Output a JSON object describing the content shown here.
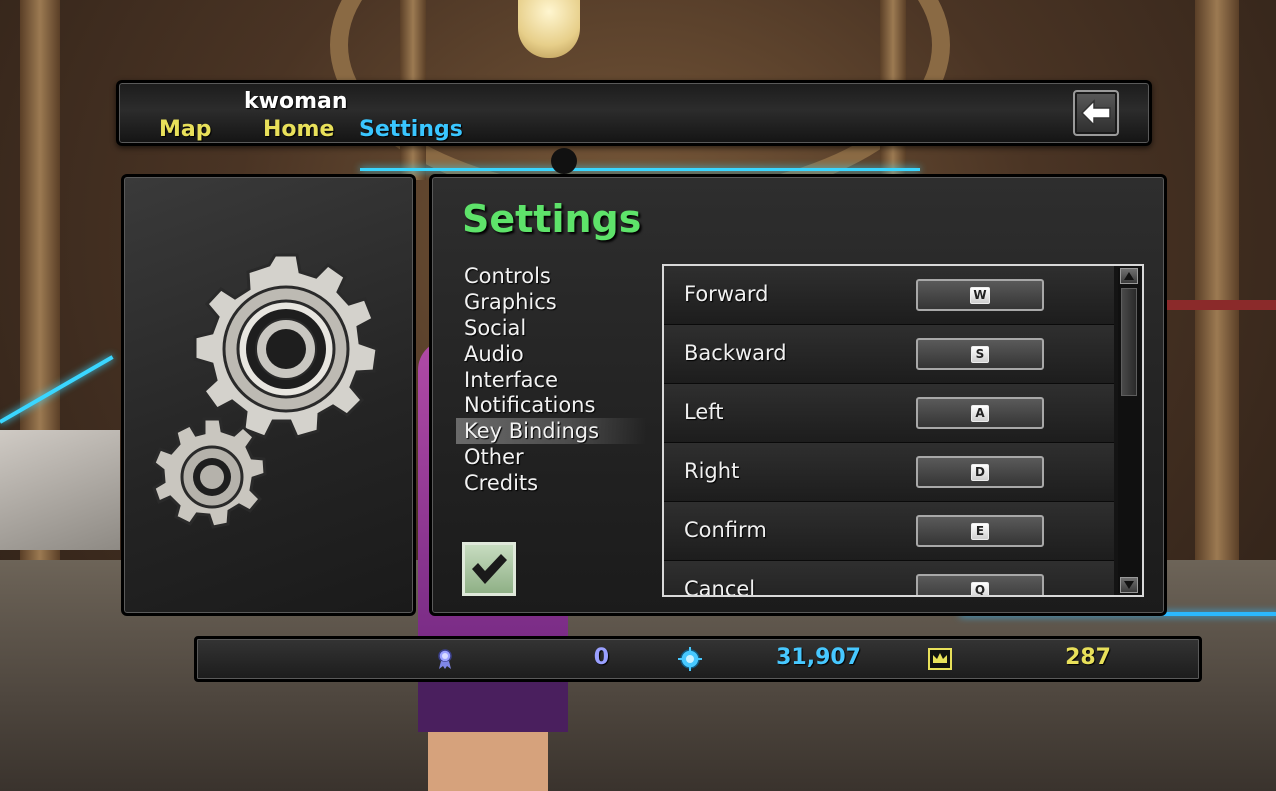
{
  "header": {
    "username": "kwoman",
    "nav": {
      "map": "Map",
      "home": "Home",
      "settings": "Settings"
    },
    "back_icon": "back-arrow-icon"
  },
  "settings": {
    "title": "Settings",
    "menu": [
      {
        "label": "Controls",
        "active": false
      },
      {
        "label": "Graphics",
        "active": false
      },
      {
        "label": "Social",
        "active": false
      },
      {
        "label": "Audio",
        "active": false
      },
      {
        "label": "Interface",
        "active": false
      },
      {
        "label": "Notifications",
        "active": false
      },
      {
        "label": "Key Bindings",
        "active": true
      },
      {
        "label": "Other",
        "active": false
      },
      {
        "label": "Credits",
        "active": false
      }
    ],
    "confirm_icon": "checkmark-icon"
  },
  "key_bindings": [
    {
      "action": "Forward",
      "key": "W"
    },
    {
      "action": "Backward",
      "key": "S"
    },
    {
      "action": "Left",
      "key": "A"
    },
    {
      "action": "Right",
      "key": "D"
    },
    {
      "action": "Confirm",
      "key": "E"
    },
    {
      "action": "Cancel",
      "key": "Q"
    }
  ],
  "currency": {
    "ribbon": {
      "icon": "ribbon-medal-icon",
      "value": "0",
      "color": "#9aa0ff"
    },
    "gems": {
      "icon": "gear-gem-icon",
      "value": "31,907",
      "color": "#47c8ff"
    },
    "crowns": {
      "icon": "crown-icon",
      "value": "287",
      "color": "#e8e05a"
    }
  },
  "colors": {
    "title_green": "#5ee36a",
    "nav_yellow": "#e8e05a",
    "nav_active_blue": "#3ac6ff"
  }
}
